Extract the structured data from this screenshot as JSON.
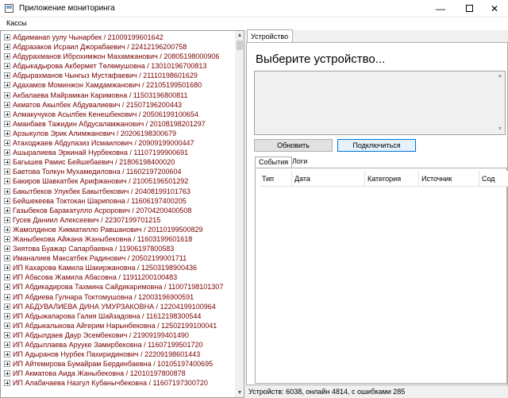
{
  "window": {
    "title": "Приложение мониторинга"
  },
  "menu": {
    "items": [
      "Кассы"
    ]
  },
  "tree": {
    "items": [
      "Абдиманап уулу Чынарбек / 21009199601642",
      "Абдразаков Исраил Джорабаевич / 22412196200758",
      "Абдурахманов Иброхимжон Махамжанович / 20805198000906",
      "Абдыкадырова Акбермет Төлөмушовна / 13010196700813",
      "Абдырахманов Чынгыз Мустафаевич / 21110198601629",
      "Адахамов Моминжон Хамдамжанович / 22105199501680",
      "Акбалаева Майрамкан Каримовна / 11503196800811",
      "Акматов Акылбек Абдувалиевич / 21507196200443",
      "Алмакучуков Асылбек Кенешбекович / 20506199100654",
      "Аманбаев Тажидин Абдусаламжанович / 20108198201297",
      "Арзыкулов Эрик Алимжанович / 20206198300679",
      "Атаходжаев Абдулазиз Исмаилович / 20909199000447",
      "Ашыралиева Эркинай Нурбековна / 11107199900691",
      "Багышев Рамис Бейшебаевич / 21806198400020",
      "Баетова Толкун Мухамедиловна / 11602197200604",
      "Бакиров Шавкатбек Арифжанович / 21005196501292",
      "Бакытбеков Улукбек Бакытбекович / 20408199101763",
      "Бейшекеева Токтокан Шариповна / 11606197400205",
      "Газыбеков Баракатулло Асрорович / 20704200400508",
      "Гусев Даниил Алексеевич / 22307199701215",
      "Жамолдинов Хикматилло Равшанович / 20110199500829",
      "Жаныбекова Айжана Жаныбековна / 11603199601618",
      "Зиятова Буажар Сапарбаевна / 11906197800583",
      "Иманалиев Максатбек Радинович / 20502199001711",
      "ИП  Кахарова Камила Шакиржановна / 12503198900436",
      "ИП Абасова Жамила Абасовна / 11911200100483",
      "ИП Абдикадирова Тахмина Сайдикаримовна / 11007198101307",
      "ИП Абдиева Гулнара Токтомушовна / 12003196900591",
      "ИП АБДУВАЛИЕВА ДИНА УМУРЗАКОВНА / 12204199100964",
      "ИП Абдыжапарова Галия Шайзадовна / 11612198300544",
      "ИП Абдыкалыкова Айгерим Нарынбековна / 12502199100041",
      "ИП Абдылдаев Даур Эсембекович / 21909199401490",
      "ИП Абдыллаева Арууке Замирбековна / 11607199501720",
      "ИП Адыранов Нурбек Пахиридинович / 22209198601443",
      "ИП Айтемирова Бумайрам Бердинбаевна / 10105197400695",
      "ИП Акматова Аида Жаныбековна / 12010197800878",
      "ИП Алабачаева Назгул Кубанычбековна / 11607197300720"
    ]
  },
  "device_tab": {
    "label": "Устройство"
  },
  "device": {
    "heading": "Выберите устройство...",
    "refresh_label": "Обновить",
    "connect_label": "Подключиться"
  },
  "subtabs": {
    "events": "События",
    "logs": "Логи"
  },
  "events_table": {
    "columns": [
      "Тип",
      "Дата",
      "Категория",
      "Источник",
      "Сод"
    ]
  },
  "status": {
    "text": "Устройств: 6038, онлайн 4814, с ошибками 285"
  }
}
